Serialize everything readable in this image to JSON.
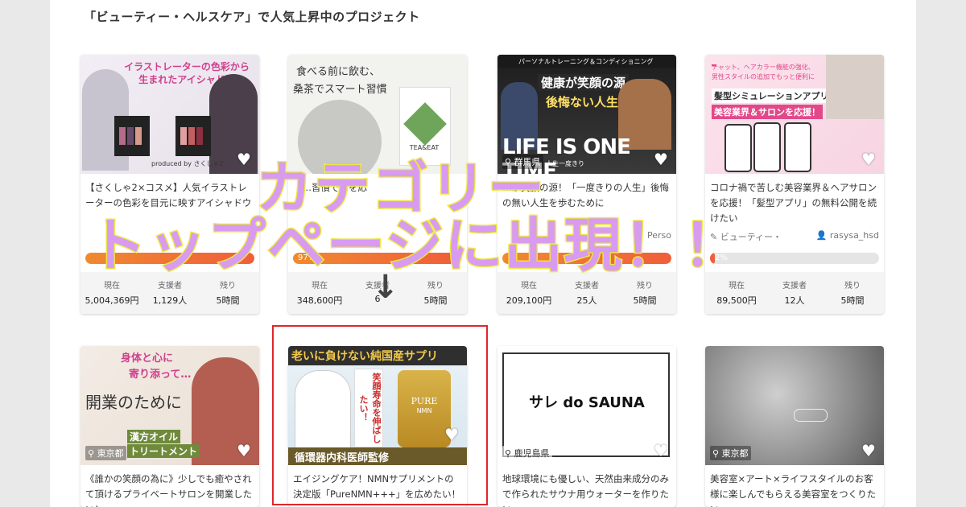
{
  "heading": "「ビューティー・ヘルスケア」で人気上昇中のプロジェクト",
  "overlay": {
    "line1": "カテゴリー",
    "line2": "トップページに出現！！",
    "arrow": "↓"
  },
  "stat_labels": {
    "current": "現在",
    "supporters": "支援者",
    "remaining": "残り"
  },
  "row1": [
    {
      "image_text_a": "イラストレーターの色彩から",
      "image_text_b": "生まれたアイシャドウ",
      "image_text_c": "produced by さくしゃ2",
      "title": "【さくしゃ2×コスメ】人気イラストレーターの色彩を目元に映すアイシャドウ",
      "bar_color": "#f07a35",
      "bar_fraction": 1.0,
      "current": "5,004,369円",
      "supporters": "1,129人",
      "remaining": "5時間"
    },
    {
      "image_text_a": "食べる前に飲む、",
      "image_text_b": "桑茶でスマート習慣",
      "image_text_c": "TEA&EAT",
      "title": "【…習慣で…を応",
      "bar_pct": "97%",
      "bar_color": "#f07a35",
      "bar_fraction": 0.97,
      "current": "348,600円",
      "supporters": "6",
      "remaining": "5時間"
    },
    {
      "image_text_a": "パーソナルトレーニング＆コンディショニング",
      "image_text_b": "健康が笑顔の源",
      "image_text_c": "後悔ない人生を",
      "image_text_d": "LIFE IS ONE TIME",
      "image_text_e": "人生一度きり",
      "location": "群馬県",
      "title": "…が笑顔の源！「一度きりの人生」後悔の無い人生を歩むために",
      "user": "Perso",
      "bar_color": "#f07a35",
      "bar_fraction": 1.0,
      "current": "209,100円",
      "supporters": "25人",
      "remaining": "5時間"
    },
    {
      "image_text_a": "チャット、ヘアカラー機能の強化、",
      "image_text_b": "男性スタイルの追加でもっと便利に",
      "image_text_c": "髪型シミュレーションアプリで",
      "image_text_d": "美容業界＆サロンを応援！",
      "title": "コロナ禍で苦しむ美容業界＆ヘアサロンを応援！「髪型アプリ」の無料公開を続けたい",
      "tag": "ビューティー・",
      "user": "rasysa_hsd",
      "bar_pct": "2%",
      "bar_color": "#f07a35",
      "bar_fraction": 0.02,
      "current": "89,500円",
      "supporters": "12人",
      "remaining": "5時間"
    }
  ],
  "row2": [
    {
      "image_text_a": "身体と心に",
      "image_text_b": "寄り添って…",
      "image_text_c": "開業のために",
      "image_text_d": "漢方オイル",
      "image_text_e": "トリートメント",
      "location": "東京都",
      "title": "《誰かの笑顔の為に》少しでも癒やされて頂けるプライベートサロンを開業したい！"
    },
    {
      "image_text_a": "老いに負けない純国産サプリ",
      "image_text_b": "笑顔寿命を伸ばしたい！",
      "image_text_c": "PURE",
      "image_text_d": "NMN",
      "image_text_e": "循環器内科医師監修",
      "title": "エイジングケア！NMNサプリメントの決定版「PureNMN+++」を広めたい！"
    },
    {
      "image_text_a": "サレ do SAUNA",
      "location": "鹿児島県",
      "title": "地球環境にも優しい、天然由来成分のみで作られたサウナ用ウォーターを作りたい"
    },
    {
      "location": "東京都",
      "title": "美容室×アート×ライフスタイルのお客様に楽しんでもらえる美容室をつくりたい。"
    }
  ]
}
